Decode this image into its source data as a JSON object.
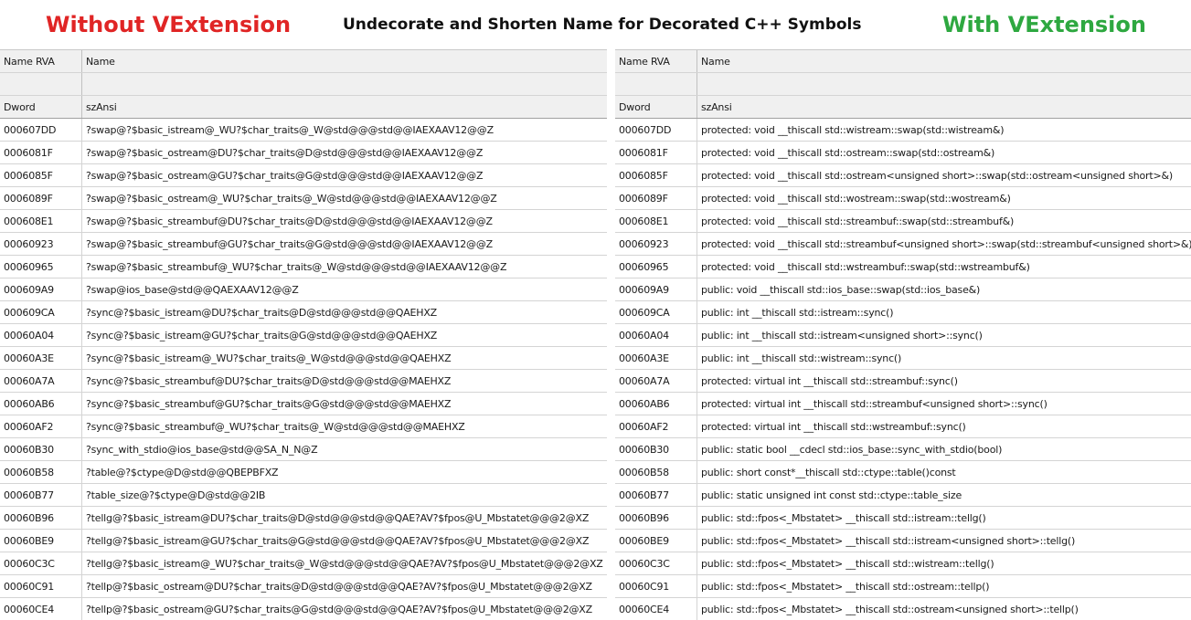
{
  "titles": {
    "without": "Without VExtension",
    "main": "Undecorate and Shorten Name for Decorated C++ Symbols",
    "with": "With VExtension"
  },
  "colors": {
    "without": "#e02525",
    "with": "#2ea840",
    "main": "#111111"
  },
  "left_table": {
    "headers": [
      "Name RVA",
      "Name"
    ],
    "type_row": [
      "Dword",
      "szAnsi"
    ],
    "rows": [
      [
        "000607DD",
        "?swap@?$basic_istream@_WU?$char_traits@_W@std@@@std@@IAEXAAV12@@Z"
      ],
      [
        "0006081F",
        "?swap@?$basic_ostream@DU?$char_traits@D@std@@@std@@IAEXAAV12@@Z"
      ],
      [
        "0006085F",
        "?swap@?$basic_ostream@GU?$char_traits@G@std@@@std@@IAEXAAV12@@Z"
      ],
      [
        "0006089F",
        "?swap@?$basic_ostream@_WU?$char_traits@_W@std@@@std@@IAEXAAV12@@Z"
      ],
      [
        "000608E1",
        "?swap@?$basic_streambuf@DU?$char_traits@D@std@@@std@@IAEXAAV12@@Z"
      ],
      [
        "00060923",
        "?swap@?$basic_streambuf@GU?$char_traits@G@std@@@std@@IAEXAAV12@@Z"
      ],
      [
        "00060965",
        "?swap@?$basic_streambuf@_WU?$char_traits@_W@std@@@std@@IAEXAAV12@@Z"
      ],
      [
        "000609A9",
        "?swap@ios_base@std@@QAEXAAV12@@Z"
      ],
      [
        "000609CA",
        "?sync@?$basic_istream@DU?$char_traits@D@std@@@std@@QAEHXZ"
      ],
      [
        "00060A04",
        "?sync@?$basic_istream@GU?$char_traits@G@std@@@std@@QAEHXZ"
      ],
      [
        "00060A3E",
        "?sync@?$basic_istream@_WU?$char_traits@_W@std@@@std@@QAEHXZ"
      ],
      [
        "00060A7A",
        "?sync@?$basic_streambuf@DU?$char_traits@D@std@@@std@@MAEHXZ"
      ],
      [
        "00060AB6",
        "?sync@?$basic_streambuf@GU?$char_traits@G@std@@@std@@MAEHXZ"
      ],
      [
        "00060AF2",
        "?sync@?$basic_streambuf@_WU?$char_traits@_W@std@@@std@@MAEHXZ"
      ],
      [
        "00060B30",
        "?sync_with_stdio@ios_base@std@@SA_N_N@Z"
      ],
      [
        "00060B58",
        "?table@?$ctype@D@std@@QBEPBFXZ"
      ],
      [
        "00060B77",
        "?table_size@?$ctype@D@std@@2IB"
      ],
      [
        "00060B96",
        "?tellg@?$basic_istream@DU?$char_traits@D@std@@@std@@QAE?AV?$fpos@U_Mbstatet@@@2@XZ"
      ],
      [
        "00060BE9",
        "?tellg@?$basic_istream@GU?$char_traits@G@std@@@std@@QAE?AV?$fpos@U_Mbstatet@@@2@XZ"
      ],
      [
        "00060C3C",
        "?tellg@?$basic_istream@_WU?$char_traits@_W@std@@@std@@QAE?AV?$fpos@U_Mbstatet@@@2@XZ"
      ],
      [
        "00060C91",
        "?tellp@?$basic_ostream@DU?$char_traits@D@std@@@std@@QAE?AV?$fpos@U_Mbstatet@@@2@XZ"
      ],
      [
        "00060CE4",
        "?tellp@?$basic_ostream@GU?$char_traits@G@std@@@std@@QAE?AV?$fpos@U_Mbstatet@@@2@XZ"
      ]
    ]
  },
  "right_table": {
    "headers": [
      "Name RVA",
      "Name"
    ],
    "type_row": [
      "Dword",
      "szAnsi"
    ],
    "rows": [
      [
        "000607DD",
        "protected: void __thiscall std::wistream::swap(std::wistream&)"
      ],
      [
        "0006081F",
        "protected: void __thiscall std::ostream::swap(std::ostream&)"
      ],
      [
        "0006085F",
        "protected: void __thiscall std::ostream<unsigned short>::swap(std::ostream<unsigned short>&)"
      ],
      [
        "0006089F",
        "protected: void __thiscall std::wostream::swap(std::wostream&)"
      ],
      [
        "000608E1",
        "protected: void __thiscall std::streambuf::swap(std::streambuf&)"
      ],
      [
        "00060923",
        "protected: void __thiscall std::streambuf<unsigned short>::swap(std::streambuf<unsigned short>&)"
      ],
      [
        "00060965",
        "protected: void __thiscall std::wstreambuf::swap(std::wstreambuf&)"
      ],
      [
        "000609A9",
        "public: void __thiscall std::ios_base::swap(std::ios_base&)"
      ],
      [
        "000609CA",
        "public: int __thiscall std::istream::sync()"
      ],
      [
        "00060A04",
        "public: int __thiscall std::istream<unsigned short>::sync()"
      ],
      [
        "00060A3E",
        "public: int __thiscall std::wistream::sync()"
      ],
      [
        "00060A7A",
        "protected: virtual int __thiscall std::streambuf::sync()"
      ],
      [
        "00060AB6",
        "protected: virtual int __thiscall std::streambuf<unsigned short>::sync()"
      ],
      [
        "00060AF2",
        "protected: virtual int __thiscall std::wstreambuf::sync()"
      ],
      [
        "00060B30",
        "public: static bool __cdecl std::ios_base::sync_with_stdio(bool)"
      ],
      [
        "00060B58",
        "public: short const*__thiscall std::ctype::table()const"
      ],
      [
        "00060B77",
        "public: static unsigned int const std::ctype::table_size"
      ],
      [
        "00060B96",
        "public: std::fpos<_Mbstatet> __thiscall std::istream::tellg()"
      ],
      [
        "00060BE9",
        "public: std::fpos<_Mbstatet> __thiscall std::istream<unsigned short>::tellg()"
      ],
      [
        "00060C3C",
        "public: std::fpos<_Mbstatet> __thiscall std::wistream::tellg()"
      ],
      [
        "00060C91",
        "public: std::fpos<_Mbstatet> __thiscall std::ostream::tellp()"
      ],
      [
        "00060CE4",
        "public: std::fpos<_Mbstatet> __thiscall std::ostream<unsigned short>::tellp()"
      ]
    ]
  }
}
